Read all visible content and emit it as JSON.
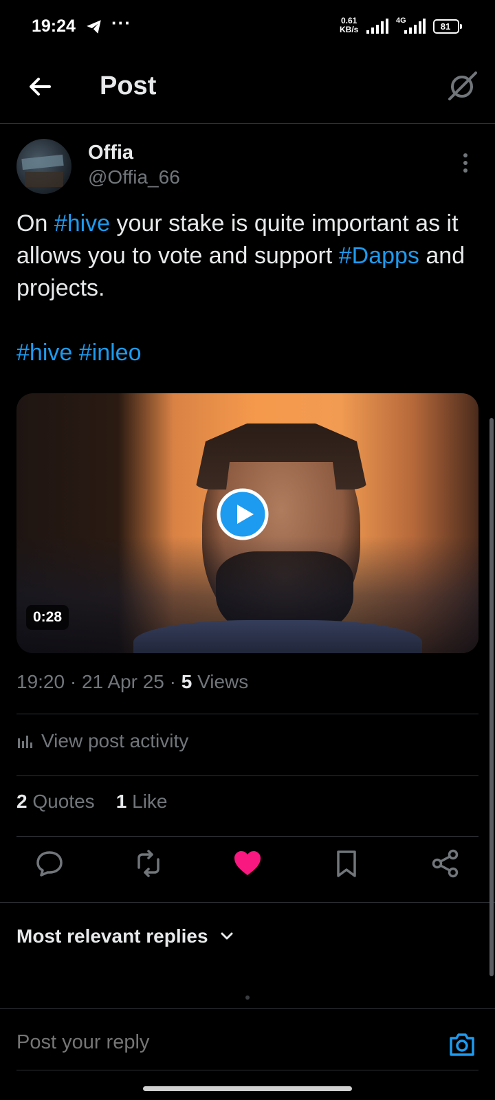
{
  "status_bar": {
    "time": "19:24",
    "more": "···",
    "net_speed_value": "0.61",
    "net_speed_unit": "KB/s",
    "network_type": "4G",
    "battery": "81"
  },
  "header": {
    "title": "Post"
  },
  "post": {
    "author_name": "Offia",
    "author_handle": "@Offia_66",
    "text_parts": [
      {
        "text": "On ",
        "tag": false
      },
      {
        "text": "#hive",
        "tag": true
      },
      {
        "text": " your stake is quite important as it allows you to vote and support ",
        "tag": false
      },
      {
        "text": "#Dapps",
        "tag": true
      },
      {
        "text": " and projects.",
        "tag": false
      }
    ],
    "tags_line": [
      "#hive",
      "#inleo"
    ],
    "video_duration": "0:28",
    "time": "19:20",
    "date": "21 Apr 25",
    "views_count": "5",
    "views_label": "Views",
    "activity_label": "View post activity",
    "quotes_count": "2",
    "quotes_label": "Quotes",
    "likes_count": "1",
    "likes_label": "Like"
  },
  "actions": {
    "liked": true,
    "like_color": "#f91880"
  },
  "replies": {
    "sort_label": "Most relevant replies",
    "reply_placeholder": "Post your reply"
  },
  "colors": {
    "accent": "#1d9bf0",
    "muted": "#71767b",
    "text": "#e7e9ea",
    "background": "#000000"
  }
}
